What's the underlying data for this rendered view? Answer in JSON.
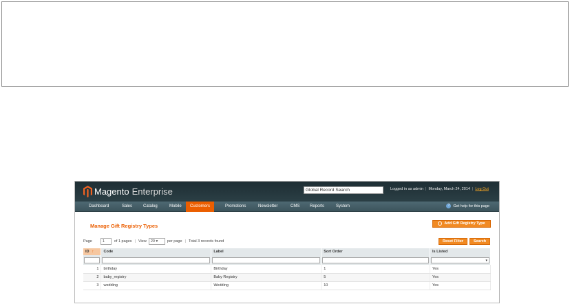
{
  "header": {
    "brand": "Magento",
    "edition": "Enterprise",
    "global_search": "Global Record Search",
    "logged_in": "Logged in as admin",
    "date": "Monday, March 24, 2014",
    "logout": "Log Out"
  },
  "nav": {
    "items": [
      {
        "label": "Dashboard"
      },
      {
        "label": "Sales"
      },
      {
        "label": "Catalog"
      },
      {
        "label": "Mobile"
      },
      {
        "label": "Customers"
      },
      {
        "label": "Promotions"
      },
      {
        "label": "Newsletter"
      },
      {
        "label": "CMS"
      },
      {
        "label": "Reports"
      },
      {
        "label": "System"
      }
    ],
    "active": "Customers",
    "help": "Get help for this page"
  },
  "page": {
    "title": "Manage Gift Registry Types",
    "add_button": "Add Gift Registry Type"
  },
  "pager": {
    "page_label": "Page",
    "page_value": "1",
    "of_pages": "of 1 pages",
    "view_label": "View",
    "per_page_value": "20",
    "per_page_label": "per page",
    "total": "Total 3 records found",
    "reset_filter": "Reset Filter",
    "search": "Search"
  },
  "grid": {
    "columns": [
      "ID",
      "Code",
      "Label",
      "Sort Order",
      "Is Listed"
    ],
    "rows": [
      {
        "id": "1",
        "code": "birthday",
        "label": "Birthday",
        "sort": "1",
        "listed": "Yes"
      },
      {
        "id": "2",
        "code": "baby_registry",
        "label": "Baby Registry",
        "sort": "5",
        "listed": "Yes"
      },
      {
        "id": "3",
        "code": "wedding",
        "label": "Wedding",
        "sort": "10",
        "listed": "Yes"
      }
    ]
  },
  "colors": {
    "accent": "#eb5e00",
    "button": "#f18a23",
    "header_bg": "#1e2e34",
    "nav_bg": "#4e6973"
  }
}
